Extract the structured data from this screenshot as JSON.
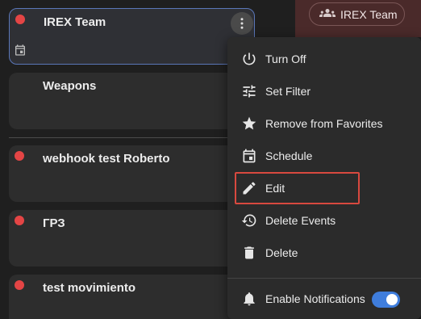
{
  "header": {
    "team_label": "IREX Team",
    "team_icon": "group-icon"
  },
  "cards": [
    {
      "title": "IREX Team",
      "status_color": "#e44545",
      "selected": true,
      "icon": "calendar-icon"
    },
    {
      "title": "Weapons",
      "status_color": "",
      "selected": false
    },
    {
      "title": "webhook test Roberto",
      "status_color": "#e44545",
      "selected": false
    },
    {
      "title": "ГРЗ",
      "status_color": "#e44545",
      "selected": false
    },
    {
      "title": "test movimiento",
      "status_color": "#e44545",
      "selected": false
    }
  ],
  "menu": {
    "items": [
      {
        "label": "Turn Off",
        "icon": "power-icon"
      },
      {
        "label": "Set Filter",
        "icon": "tune-icon"
      },
      {
        "label": "Remove from Favorites",
        "icon": "star-icon"
      },
      {
        "label": "Schedule",
        "icon": "calendar-icon"
      },
      {
        "label": "Edit",
        "icon": "pencil-icon",
        "highlighted": true
      },
      {
        "label": "Delete Events",
        "icon": "history-icon"
      },
      {
        "label": "Delete",
        "icon": "trash-icon"
      }
    ],
    "notifications": {
      "label": "Enable Notifications",
      "icon": "bell-icon",
      "enabled": true
    }
  },
  "colors": {
    "accent": "#3f7ddc",
    "status_dot": "#e44545",
    "highlight": "#d8493f"
  }
}
